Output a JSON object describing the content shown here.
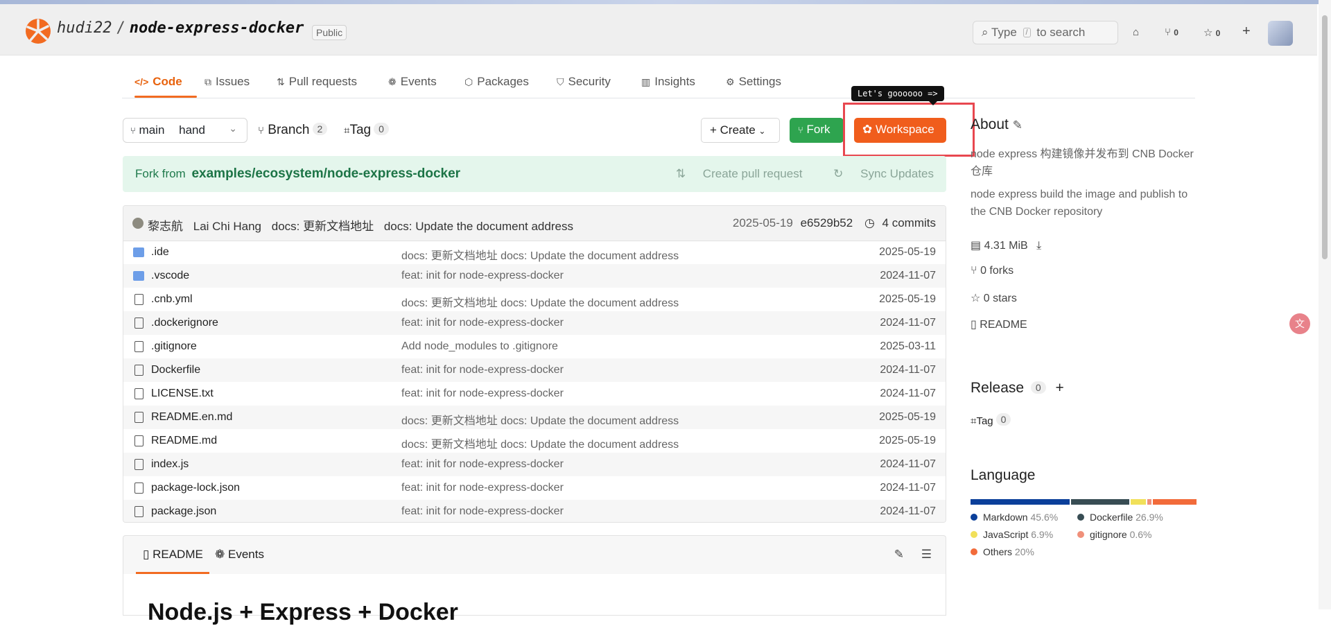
{
  "header": {
    "owner": "hudi22",
    "separator": "/",
    "repo": "node-express-docker",
    "visibility": "Public",
    "search": {
      "prefix": "Type",
      "key": "/",
      "suffix": "to search"
    },
    "fork_count": "0",
    "star_count": "0"
  },
  "nav": {
    "tabs": [
      {
        "icon": "</>",
        "label": "Code"
      },
      {
        "icon": "⧉",
        "label": "Issues"
      },
      {
        "icon": "⇅",
        "label": "Pull requests"
      },
      {
        "icon": "❁",
        "label": "Events"
      },
      {
        "icon": "⬡",
        "label": "Packages"
      },
      {
        "icon": "⛉",
        "label": "Security"
      },
      {
        "icon": "▥",
        "label": "Insights"
      },
      {
        "icon": "⚙",
        "label": "Settings"
      }
    ]
  },
  "toolbar": {
    "branch_prefix": "main",
    "branch_value": "hand",
    "branch_label": "Branch",
    "branch_count": "2",
    "tag_label": "Tag",
    "tag_count": "0",
    "create_label": "+ Create",
    "fork_label": "Fork",
    "workspace_label": "Workspace",
    "tooltip": "Let's goooooo =>"
  },
  "fork_banner": {
    "prefix": "Fork from",
    "source": "examples/ecosystem/node-express-docker",
    "create_pr": "Create pull request",
    "sync": "Sync Updates"
  },
  "last_commit": {
    "author1": "黎志航",
    "author2": "Lai Chi Hang",
    "message_cn": "docs: 更新文档地址",
    "message_en": "docs: Update the document address",
    "date": "2025-05-19",
    "hash": "e6529b52",
    "commits": "4 commits"
  },
  "files": [
    {
      "type": "folder",
      "name": ".ide",
      "msg": "docs: 更新文档地址  docs: Update the document address",
      "date": "2025-05-19"
    },
    {
      "type": "folder",
      "name": ".vscode",
      "msg": "feat: init for node-express-docker",
      "date": "2024-11-07"
    },
    {
      "type": "file",
      "name": ".cnb.yml",
      "msg": "docs: 更新文档地址  docs: Update the document address",
      "date": "2025-05-19"
    },
    {
      "type": "file",
      "name": ".dockerignore",
      "msg": "feat: init for node-express-docker",
      "date": "2024-11-07"
    },
    {
      "type": "file",
      "name": ".gitignore",
      "msg": "Add node_modules to .gitignore",
      "date": "2025-03-11"
    },
    {
      "type": "file",
      "name": "Dockerfile",
      "msg": "feat: init for node-express-docker",
      "date": "2024-11-07"
    },
    {
      "type": "file",
      "name": "LICENSE.txt",
      "msg": "feat: init for node-express-docker",
      "date": "2024-11-07"
    },
    {
      "type": "file",
      "name": "README.en.md",
      "msg": "docs: 更新文档地址  docs: Update the document address",
      "date": "2025-05-19"
    },
    {
      "type": "file",
      "name": "README.md",
      "msg": "docs: 更新文档地址  docs: Update the document address",
      "date": "2025-05-19"
    },
    {
      "type": "file",
      "name": "index.js",
      "msg": "feat: init for node-express-docker",
      "date": "2024-11-07"
    },
    {
      "type": "file",
      "name": "package-lock.json",
      "msg": "feat: init for node-express-docker",
      "date": "2024-11-07"
    },
    {
      "type": "file",
      "name": "package.json",
      "msg": "feat: init for node-express-docker",
      "date": "2024-11-07"
    }
  ],
  "readme": {
    "tab_readme": "README",
    "tab_events": "Events",
    "heading": "Node.js + Express + Docker"
  },
  "about": {
    "title": "About",
    "desc_cn": "node express 构建镜像并发布到 CNB Docker 仓库",
    "desc_en": "node express build the image and publish to the CNB Docker repository",
    "size": "4.31 MiB",
    "forks": "0 forks",
    "stars": "0 stars",
    "readme": "README"
  },
  "release": {
    "title": "Release",
    "count": "0",
    "add": "+",
    "tag_label": "Tag",
    "tag_count": "0"
  },
  "language": {
    "title": "Language",
    "items": [
      {
        "name": "Markdown",
        "pct": "45.6%",
        "value": 45.6,
        "color": "#0b3f9a"
      },
      {
        "name": "Dockerfile",
        "pct": "26.9%",
        "value": 26.9,
        "color": "#384d54"
      },
      {
        "name": "JavaScript",
        "pct": "6.9%",
        "value": 6.9,
        "color": "#f1e05a"
      },
      {
        "name": "gitignore",
        "pct": "0.6%",
        "value": 0.6,
        "color": "#f0907a"
      },
      {
        "name": "Others",
        "pct": "20%",
        "value": 20,
        "color": "#f26b3a"
      }
    ]
  }
}
